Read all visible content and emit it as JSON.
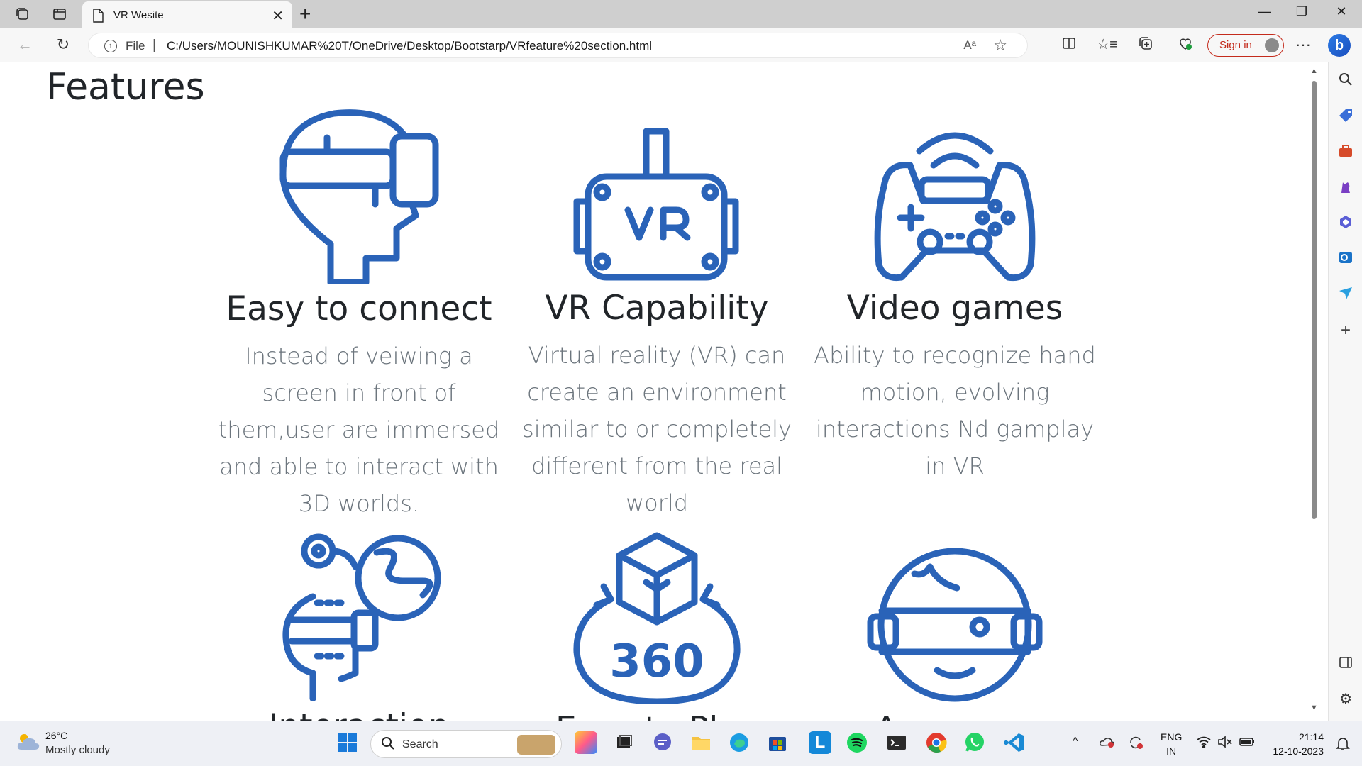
{
  "browser": {
    "tab_title": "VR Wesite",
    "url_scheme": "File",
    "url": "C:/Users/MOUNISHKUMAR%20T/OneDrive/Desktop/Bootstarp/VRfeature%20section.html",
    "signin_label": "Sign in",
    "bing_label": "b"
  },
  "page": {
    "heading": "Features",
    "features": [
      {
        "title": "Easy to connect",
        "text": "Instead of veiwing a screen in front of them,user are immersed and able to interact with 3D worlds.",
        "icon": "vr-headset-head-icon"
      },
      {
        "title": "VR Capability",
        "text": "Virtual reality (VR) can create an environment similar to or completely different from the real world",
        "icon": "vr-goggles-icon"
      },
      {
        "title": "Video games",
        "text": "Ability to recognize hand motion, evolving interactions Nd gamplay in VR",
        "icon": "gamepad-icon"
      },
      {
        "title": "Interaction",
        "icon": "interaction-head-icon"
      },
      {
        "title": "Easy to Play",
        "icon": "360-cube-icon",
        "label_360": "360"
      },
      {
        "title": "Awesome",
        "icon": "vr-face-icon"
      }
    ]
  },
  "taskbar": {
    "temperature": "26°C",
    "weather": "Mostly cloudy",
    "search_label": "Search",
    "lang_line1": "ENG",
    "lang_line2": "IN",
    "time": "21:14",
    "date": "12-10-2023"
  },
  "colors": {
    "icon_blue": "#2a63b8",
    "heading": "#212529",
    "muted": "#6c757d",
    "signin_red": "#c42b1c"
  }
}
